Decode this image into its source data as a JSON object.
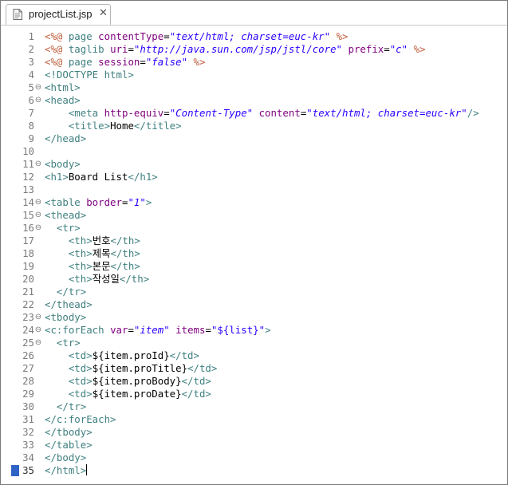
{
  "tab": {
    "file_name": "projectList.jsp",
    "close_glyph": "✕",
    "icon": "jsp-file-icon"
  },
  "editor": {
    "lines": [
      {
        "n": "1",
        "fold": "",
        "tokens": [
          [
            "dir",
            "<%@ "
          ],
          [
            "kw",
            "page "
          ],
          [
            "attr",
            "contentType"
          ],
          [
            "txt",
            "="
          ],
          [
            "stri",
            "\"text/html; charset=euc-kr\""
          ],
          [
            "dir",
            " %>"
          ]
        ]
      },
      {
        "n": "2",
        "fold": "",
        "tokens": [
          [
            "dir",
            "<%@ "
          ],
          [
            "kw",
            "taglib "
          ],
          [
            "attr",
            "uri"
          ],
          [
            "txt",
            "="
          ],
          [
            "stri",
            "\"http://java.sun.com/jsp/jstl/core\""
          ],
          [
            "txt",
            " "
          ],
          [
            "attr",
            "prefix"
          ],
          [
            "txt",
            "="
          ],
          [
            "stri",
            "\"c\""
          ],
          [
            "dir",
            " %>"
          ]
        ]
      },
      {
        "n": "3",
        "fold": "",
        "tokens": [
          [
            "dir",
            "<%@ "
          ],
          [
            "kw",
            "page "
          ],
          [
            "attr",
            "session"
          ],
          [
            "txt",
            "="
          ],
          [
            "stri",
            "\"false\""
          ],
          [
            "dir",
            " %>"
          ]
        ]
      },
      {
        "n": "4",
        "fold": "",
        "tokens": [
          [
            "kw",
            "<!DOCTYPE html>"
          ]
        ]
      },
      {
        "n": "5",
        "fold": "⊖",
        "tokens": [
          [
            "kw",
            "<html>"
          ]
        ]
      },
      {
        "n": "6",
        "fold": "⊖",
        "tokens": [
          [
            "kw",
            "<head>"
          ]
        ]
      },
      {
        "n": "7",
        "fold": "",
        "tokens": [
          [
            "txt",
            "    "
          ],
          [
            "kw",
            "<meta "
          ],
          [
            "attr",
            "http-equiv"
          ],
          [
            "txt",
            "="
          ],
          [
            "stri",
            "\"Content-Type\""
          ],
          [
            "txt",
            " "
          ],
          [
            "attr",
            "content"
          ],
          [
            "txt",
            "="
          ],
          [
            "stri",
            "\"text/html; charset=euc-kr\""
          ],
          [
            "kw",
            "/>"
          ]
        ]
      },
      {
        "n": "8",
        "fold": "",
        "tokens": [
          [
            "txt",
            "    "
          ],
          [
            "kw",
            "<title>"
          ],
          [
            "txt",
            "Home"
          ],
          [
            "kw",
            "</title>"
          ]
        ]
      },
      {
        "n": "9",
        "fold": "",
        "tokens": [
          [
            "kw",
            "</head>"
          ]
        ]
      },
      {
        "n": "10",
        "fold": "",
        "tokens": []
      },
      {
        "n": "11",
        "fold": "⊖",
        "tokens": [
          [
            "kw",
            "<body>"
          ]
        ]
      },
      {
        "n": "12",
        "fold": "",
        "tokens": [
          [
            "kw",
            "<h1>"
          ],
          [
            "txt",
            "Board List"
          ],
          [
            "kw",
            "</h1>"
          ]
        ]
      },
      {
        "n": "13",
        "fold": "",
        "tokens": []
      },
      {
        "n": "14",
        "fold": "⊖",
        "tokens": [
          [
            "kw",
            "<table "
          ],
          [
            "attr",
            "border"
          ],
          [
            "txt",
            "="
          ],
          [
            "stri",
            "\"1\""
          ],
          [
            "kw",
            ">"
          ]
        ]
      },
      {
        "n": "15",
        "fold": "⊖",
        "tokens": [
          [
            "kw",
            "<thead>"
          ]
        ]
      },
      {
        "n": "16",
        "fold": "⊖",
        "tokens": [
          [
            "txt",
            "  "
          ],
          [
            "kw",
            "<tr>"
          ]
        ]
      },
      {
        "n": "17",
        "fold": "",
        "tokens": [
          [
            "txt",
            "    "
          ],
          [
            "kw",
            "<th>"
          ],
          [
            "txt",
            "번호"
          ],
          [
            "kw",
            "</th>"
          ]
        ]
      },
      {
        "n": "18",
        "fold": "",
        "tokens": [
          [
            "txt",
            "    "
          ],
          [
            "kw",
            "<th>"
          ],
          [
            "txt",
            "제목"
          ],
          [
            "kw",
            "</th>"
          ]
        ]
      },
      {
        "n": "19",
        "fold": "",
        "tokens": [
          [
            "txt",
            "    "
          ],
          [
            "kw",
            "<th>"
          ],
          [
            "txt",
            "본문"
          ],
          [
            "kw",
            "</th>"
          ]
        ]
      },
      {
        "n": "20",
        "fold": "",
        "tokens": [
          [
            "txt",
            "    "
          ],
          [
            "kw",
            "<th>"
          ],
          [
            "txt",
            "작성일"
          ],
          [
            "kw",
            "</th>"
          ]
        ]
      },
      {
        "n": "21",
        "fold": "",
        "tokens": [
          [
            "txt",
            "  "
          ],
          [
            "kw",
            "</tr>"
          ]
        ]
      },
      {
        "n": "22",
        "fold": "",
        "tokens": [
          [
            "kw",
            "</thead>"
          ]
        ]
      },
      {
        "n": "23",
        "fold": "⊖",
        "tokens": [
          [
            "kw",
            "<tbody>"
          ]
        ]
      },
      {
        "n": "24",
        "fold": "⊖",
        "tokens": [
          [
            "kw",
            "<c:forEach "
          ],
          [
            "attr",
            "var"
          ],
          [
            "txt",
            "="
          ],
          [
            "stri",
            "\"item\""
          ],
          [
            "txt",
            " "
          ],
          [
            "attr",
            "items"
          ],
          [
            "txt",
            "="
          ],
          [
            "str",
            "\"${list}\""
          ],
          [
            "kw",
            ">"
          ]
        ]
      },
      {
        "n": "25",
        "fold": "⊖",
        "tokens": [
          [
            "txt",
            "  "
          ],
          [
            "kw",
            "<tr>"
          ]
        ]
      },
      {
        "n": "26",
        "fold": "",
        "tokens": [
          [
            "txt",
            "    "
          ],
          [
            "kw",
            "<td>"
          ],
          [
            "txt",
            "${item.proId}"
          ],
          [
            "kw",
            "</td>"
          ]
        ]
      },
      {
        "n": "27",
        "fold": "",
        "tokens": [
          [
            "txt",
            "    "
          ],
          [
            "kw",
            "<td>"
          ],
          [
            "txt",
            "${item.proTitle}"
          ],
          [
            "kw",
            "</td>"
          ]
        ]
      },
      {
        "n": "28",
        "fold": "",
        "tokens": [
          [
            "txt",
            "    "
          ],
          [
            "kw",
            "<td>"
          ],
          [
            "txt",
            "${item.proBody}"
          ],
          [
            "kw",
            "</td>"
          ]
        ]
      },
      {
        "n": "29",
        "fold": "",
        "tokens": [
          [
            "txt",
            "    "
          ],
          [
            "kw",
            "<td>"
          ],
          [
            "txt",
            "${item.proDate}"
          ],
          [
            "kw",
            "</td>"
          ]
        ]
      },
      {
        "n": "30",
        "fold": "",
        "tokens": [
          [
            "txt",
            "  "
          ],
          [
            "kw",
            "</tr>"
          ]
        ]
      },
      {
        "n": "31",
        "fold": "",
        "tokens": [
          [
            "kw",
            "</c:forEach>"
          ]
        ]
      },
      {
        "n": "32",
        "fold": "",
        "tokens": [
          [
            "kw",
            "</tbody>"
          ]
        ]
      },
      {
        "n": "33",
        "fold": "",
        "tokens": [
          [
            "kw",
            "</table>"
          ]
        ]
      },
      {
        "n": "34",
        "fold": "",
        "tokens": [
          [
            "kw",
            "</body>"
          ]
        ]
      },
      {
        "n": "35",
        "fold": "",
        "tokens": [
          [
            "kw",
            "</html>"
          ]
        ],
        "caret": true
      }
    ]
  }
}
